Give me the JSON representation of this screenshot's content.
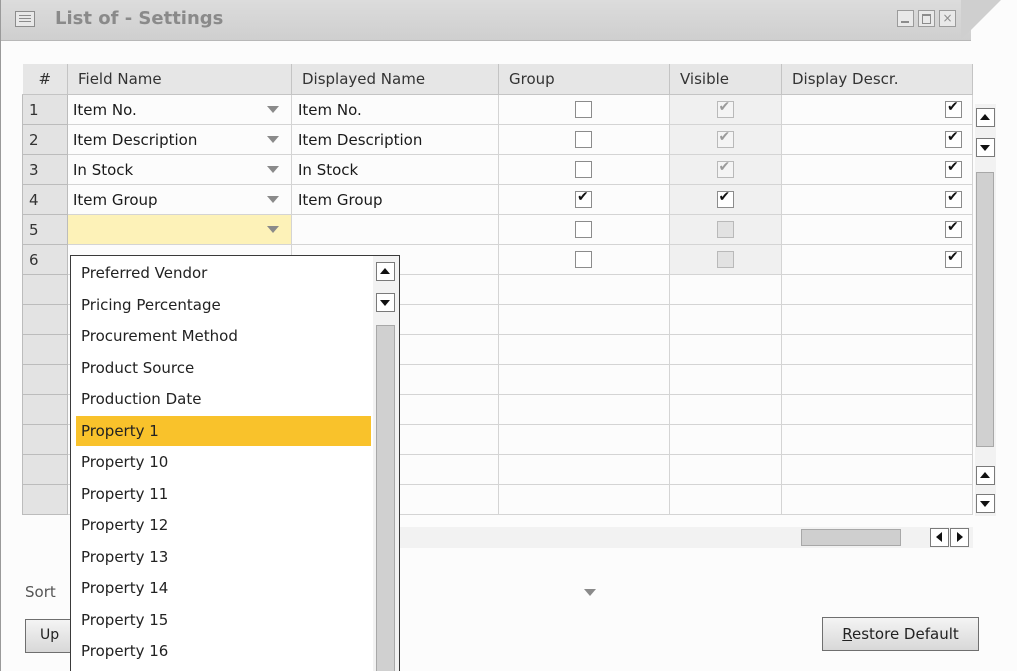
{
  "window": {
    "title": "List of - Settings",
    "close_glyph": "×"
  },
  "columns": [
    "#",
    "Field Name",
    "Displayed Name",
    "Group",
    "Visible",
    "Display Descr."
  ],
  "rows": [
    {
      "num": "1",
      "field": "Item No.",
      "displayed": "Item No.",
      "group": false,
      "visible": true,
      "visible_disabled": true,
      "descr": true
    },
    {
      "num": "2",
      "field": "Item Description",
      "displayed": "Item Description",
      "group": false,
      "visible": true,
      "visible_disabled": true,
      "descr": true
    },
    {
      "num": "3",
      "field": "In Stock",
      "displayed": "In Stock",
      "group": false,
      "visible": true,
      "visible_disabled": true,
      "descr": true
    },
    {
      "num": "4",
      "field": "Item Group",
      "displayed": "Item Group",
      "group": true,
      "visible": true,
      "visible_disabled": false,
      "descr": true
    },
    {
      "num": "5",
      "field": "",
      "displayed": "",
      "group": false,
      "visible": false,
      "visible_disabled": true,
      "descr": true
    },
    {
      "num": "6",
      "field": "",
      "displayed": "",
      "group": false,
      "visible": false,
      "visible_disabled": true,
      "descr": true
    }
  ],
  "dropdown": {
    "items": [
      "Preferred Vendor",
      "Pricing Percentage",
      "Procurement Method",
      "Product Source",
      "Production Date",
      "Property 1",
      "Property 10",
      "Property 11",
      "Property 12",
      "Property 13",
      "Property 14",
      "Property 15",
      "Property 16"
    ],
    "highlighted": "Property 1"
  },
  "sort": {
    "label": "Sort"
  },
  "buttons": {
    "update": "Up",
    "restore_prefix": "R",
    "restore_rest": "estore Default"
  },
  "colors": {
    "highlight": "#f9c22b",
    "active_cell": "#fdf2b8"
  },
  "icons": {
    "window_icon": "list-window-icon",
    "dropdown_arrow": "chevron-down-icon",
    "scroll_up": "arrow-up-icon",
    "scroll_down": "arrow-down-icon",
    "scroll_left": "arrow-left-icon",
    "scroll_right": "arrow-right-icon",
    "checkbox": "checkbox-icon"
  }
}
